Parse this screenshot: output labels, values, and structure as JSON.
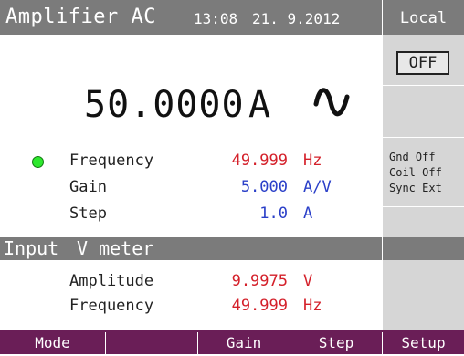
{
  "header": {
    "app_title": "Amplifier AC",
    "time": "13:08",
    "date": "21. 9.2012",
    "mode": "Local"
  },
  "output": {
    "value": "50.0000",
    "unit": "A",
    "waveform_icon": "sine-wave-icon",
    "state_button": "OFF"
  },
  "status_flags": [
    "Gnd Off",
    "Coil Off",
    "Sync Ext"
  ],
  "parameters": [
    {
      "label": "Frequency",
      "value": "49.999",
      "unit": "Hz",
      "color": "#d4202a"
    },
    {
      "label": "Gain",
      "value": "5.000",
      "unit": "A/V",
      "color": "#2a3fc8"
    },
    {
      "label": "Step",
      "value": "1.0",
      "unit": "A",
      "color": "#2a3fc8"
    }
  ],
  "input_section": {
    "title": "Input",
    "subtitle": "V meter",
    "readings": [
      {
        "label": "Amplitude",
        "value": "9.9975",
        "unit": "V"
      },
      {
        "label": "Frequency",
        "value": "49.999",
        "unit": "Hz"
      }
    ]
  },
  "softkeys": [
    "Mode",
    "",
    "Gain",
    "Step",
    "Setup"
  ],
  "colors": {
    "bar_gray": "#7b7b7b",
    "panel_gray": "#d6d6d6",
    "softkey_bg": "#6a1e57",
    "indicator_green": "#2ee82e"
  }
}
